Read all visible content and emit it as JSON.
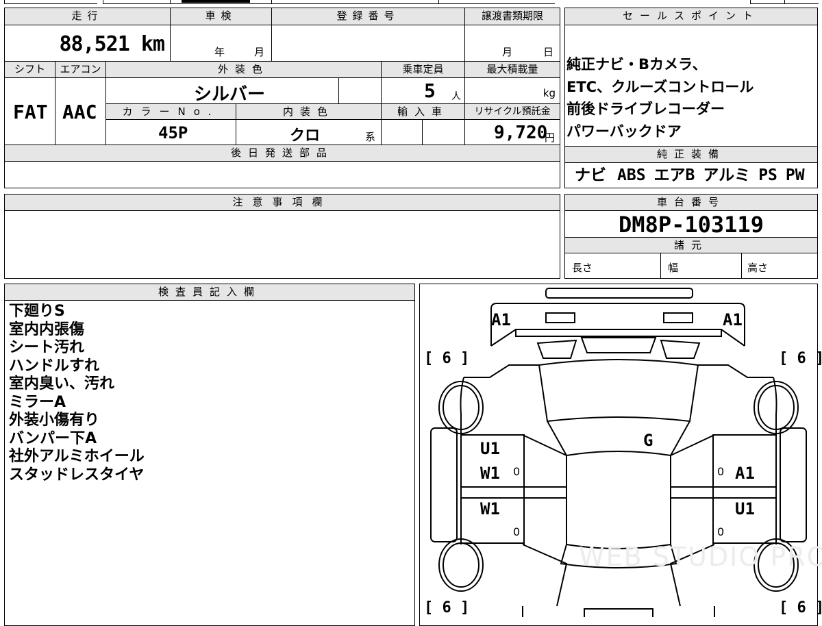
{
  "top_table": {
    "mileage_label": "走行",
    "mileage_value": "88,521 km",
    "inspection_label": "車検",
    "inspection_year_unit": "年",
    "inspection_month_unit": "月",
    "registration_label": "登録番号",
    "transfer_label": "譲渡書類期限",
    "transfer_month_unit": "月",
    "transfer_day_unit": "日",
    "shift_label": "シフト",
    "shift_value": "FAT",
    "ac_label": "エアコン",
    "ac_value": "AAC",
    "exterior_label": "外装色",
    "exterior_value": "シルバー",
    "capacity_label": "乗車定員",
    "capacity_value": "5",
    "capacity_unit": "人",
    "maxload_label": "最大積載量",
    "maxload_unit": "kg",
    "color_no_label": "カラーNo.",
    "color_no_value": "45P",
    "interior_label": "内装色",
    "interior_value": "クロ",
    "interior_suffix": "系",
    "import_label": "輸入車",
    "recycle_label": "リサイクル預託金",
    "recycle_value": "9,720",
    "recycle_unit": "円",
    "later_parts_label": "後日発送部品"
  },
  "sales_points": {
    "header": "セールスポイント",
    "lines": [
      "純正ナビ・Bカメラ、",
      "ETC、クルーズコントロール",
      "前後ドライブレコーダー",
      "パワーバックドア"
    ]
  },
  "genuine_equipment": {
    "header": "純正装備",
    "items": [
      "ナビ",
      "ABS",
      "エアB",
      "アルミ",
      "PS",
      "PW"
    ]
  },
  "caution": {
    "header": "注意事項欄"
  },
  "chassis": {
    "header": "車台番号",
    "value": "DM8P-103119",
    "spec_header": "諸元",
    "length_label": "長さ",
    "width_label": "幅",
    "height_label": "高さ"
  },
  "inspector": {
    "header": "検査員記入欄",
    "notes": [
      "下廻りS",
      "室内内張傷",
      "シート汚れ",
      "ハンドルすれ",
      "室内臭い、汚れ",
      "ミラーA",
      "外装小傷有り",
      "バンパー下A",
      "社外アルミホイール",
      "スタッドレスタイヤ"
    ]
  },
  "diagram": {
    "front_left": "A1",
    "front_right": "A1",
    "tire_fl": "[ 6 ]",
    "tire_fr": "[ 6 ]",
    "tire_rl": "[ 6 ]",
    "tire_rr": "[ 6 ]",
    "roof": "G",
    "left_front_door_1": "U1",
    "left_front_door_2": "W1",
    "left_rear_door": "W1",
    "right_front_door": "A1",
    "right_rear_door": "U1",
    "zero_a": "0",
    "zero_b": "0",
    "zero_c": "0",
    "zero_d": "0",
    "watermark": "WEB STUDIO PRO"
  }
}
